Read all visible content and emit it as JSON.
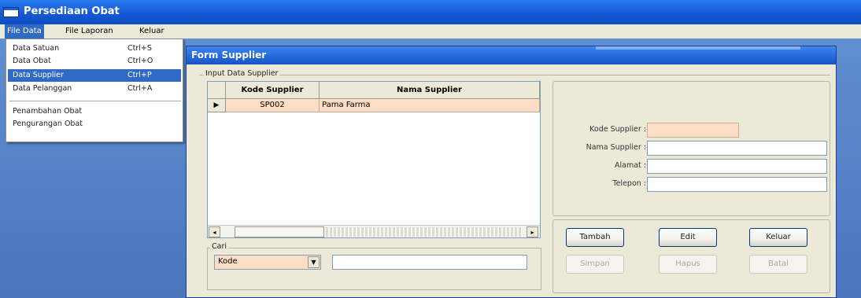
{
  "main_window": {
    "title": "Persediaan Obat"
  },
  "menubar": {
    "items": [
      {
        "label": "File Data"
      },
      {
        "label": "File Laporan"
      },
      {
        "label": "Keluar"
      }
    ]
  },
  "file_data_menu": {
    "items": [
      {
        "label": "Data Satuan",
        "shortcut": "Ctrl+S"
      },
      {
        "label": "Data Obat",
        "shortcut": "Ctrl+O"
      },
      {
        "label": "Data Supplier",
        "shortcut": "Ctrl+P"
      },
      {
        "label": "Data Pelanggan",
        "shortcut": "Ctrl+A"
      },
      {
        "label": "Penambahan Obat"
      },
      {
        "label": "Pengurangan Obat"
      }
    ]
  },
  "form": {
    "title": "Form Supplier",
    "group_title": "Input Data Supplier",
    "grid": {
      "columns": [
        "Kode Supplier",
        "Nama Supplier"
      ],
      "rows": [
        {
          "marker": "▶",
          "kode": "SP002",
          "nama": "Pama Farma"
        }
      ]
    },
    "fields": [
      {
        "label": "Kode Supplier :",
        "value": ""
      },
      {
        "label": "Nama Supplier :",
        "value": ""
      },
      {
        "label": "Alamat :",
        "value": ""
      },
      {
        "label": "Telepon :",
        "value": ""
      }
    ],
    "buttons": {
      "tambah": "Tambah",
      "edit": "Edit",
      "keluar": "Keluar",
      "simpan": "Simpan",
      "hapus": "Hapus",
      "batal": "Batal"
    },
    "cari": {
      "label": "Cari",
      "combo_value": "Kode",
      "input_value": ""
    }
  },
  "colors": {
    "highlight": "#316ac5",
    "row_peach": "#fdddc4",
    "titlebar": "#1559d6"
  }
}
